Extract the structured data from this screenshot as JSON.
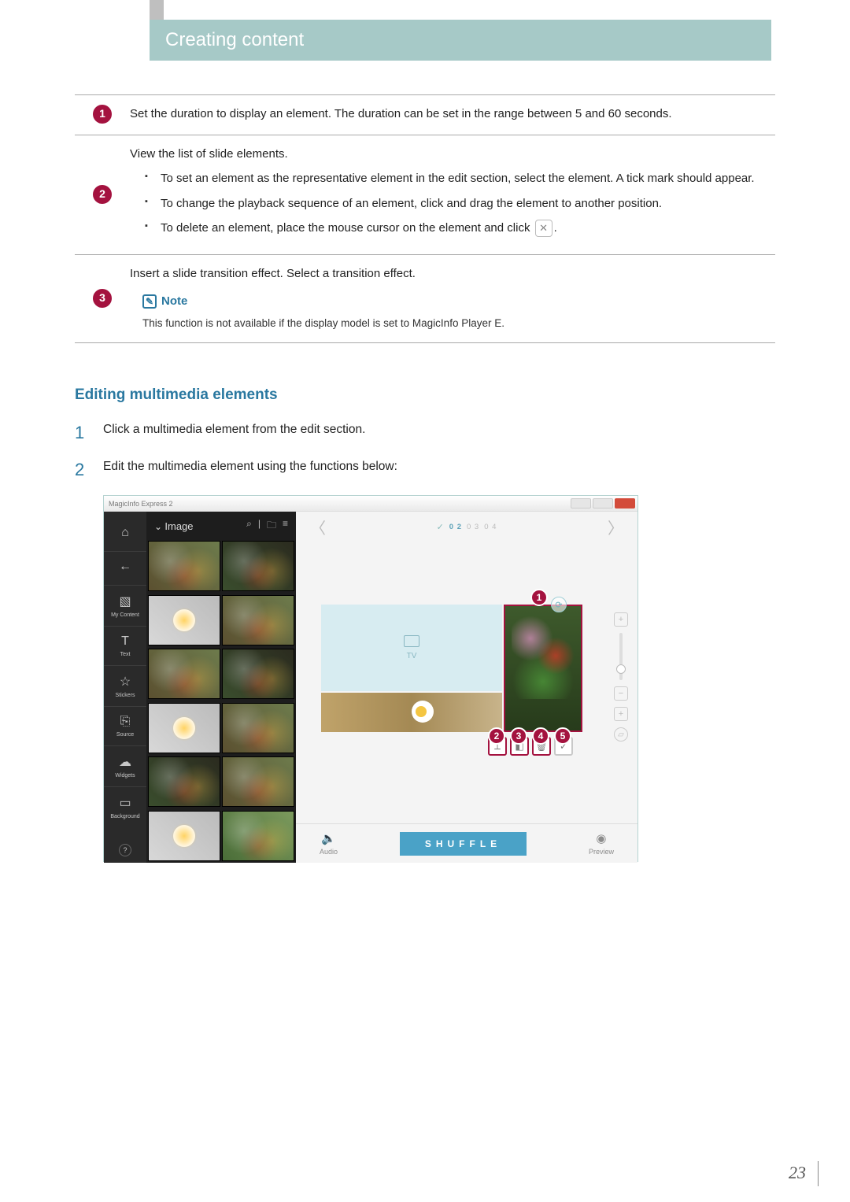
{
  "header": {
    "title": "Creating content"
  },
  "legend": [
    {
      "num": "1",
      "text": "Set the duration to display an element. The duration can be set in the range between 5 and 60 seconds."
    },
    {
      "num": "2",
      "intro": "View the list of slide elements.",
      "bullets": [
        "To set an element as the representative element in the edit section, select the element. A tick mark should appear.",
        "To change the playback sequence of an element, click and drag the element to another position.",
        "To delete an element, place the mouse cursor on the element and click"
      ],
      "bullet3_suffix": "."
    },
    {
      "num": "3",
      "intro": "Insert a slide transition effect. Select a transition effect.",
      "note_label": "Note",
      "note_body": "This function is not available if the display model is set to MagicInfo Player E."
    }
  ],
  "subheading": "Editing multimedia elements",
  "steps": [
    {
      "n": "1",
      "text": "Click a multimedia element from the edit section."
    },
    {
      "n": "2",
      "text": "Edit the multimedia element using the functions below:"
    }
  ],
  "screenshot": {
    "window_title": "MagicInfo Express 2",
    "rail": {
      "home": "",
      "back": "",
      "items": [
        {
          "label": "My Content"
        },
        {
          "label": "Text"
        },
        {
          "label": "Stickers"
        },
        {
          "label": "Source"
        },
        {
          "label": "Widgets"
        },
        {
          "label": "Background"
        }
      ]
    },
    "panel": {
      "title": "Image"
    },
    "canvas": {
      "page_indicator": {
        "active": "0 2",
        "rest1": "0 3",
        "rest2": "0 4"
      },
      "tv_label": "TV",
      "shuffle": "SHUFFLE",
      "audio": "Audio",
      "preview": "Preview"
    },
    "callouts": [
      "1",
      "2",
      "3",
      "4",
      "5"
    ]
  },
  "page_number": "23"
}
